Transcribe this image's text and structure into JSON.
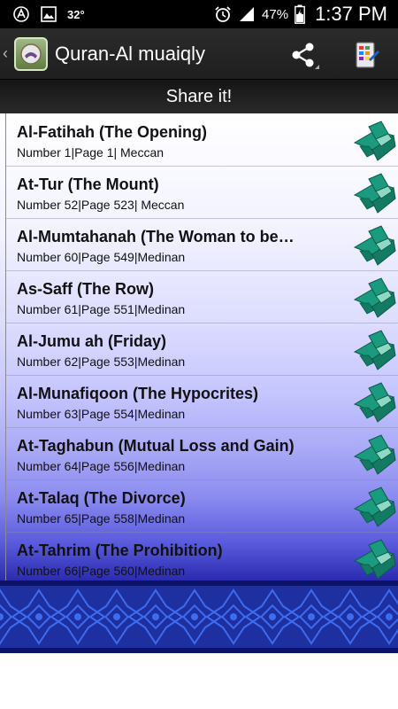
{
  "status_bar": {
    "temperature": "32°",
    "battery_percent": "47%",
    "time": "1:37 PM",
    "icons": [
      "a-circle-icon",
      "image-icon",
      "alarm-clock-icon",
      "signal-icon",
      "battery-icon"
    ]
  },
  "action_bar": {
    "title": "Quran-Al muaiqly",
    "icons": [
      "back-chevron-icon",
      "app-icon",
      "share-icon",
      "menu-icon"
    ]
  },
  "share_bar": {
    "label": "Share it!"
  },
  "surahs": [
    {
      "title": "Al-Fatihah (The Opening)",
      "subtitle": "Number 1|Page 1| Meccan"
    },
    {
      "title": "At-Tur (The Mount)",
      "subtitle": "Number 52|Page 523| Meccan"
    },
    {
      "title": "Al-Mumtahanah (The Woman to be…",
      "subtitle": "Number 60|Page 549|Medinan"
    },
    {
      "title": "As-Saff (The Row)",
      "subtitle": "Number 61|Page 551|Medinan"
    },
    {
      "title": "Al-Jumu ah (Friday)",
      "subtitle": "Number 62|Page 553|Medinan"
    },
    {
      "title": "Al-Munafiqoon (The Hypocrites)",
      "subtitle": "Number 63|Page 554|Medinan"
    },
    {
      "title": "At-Taghabun (Mutual Loss and Gain)",
      "subtitle": "Number 64|Page 556|Medinan"
    },
    {
      "title": "At-Talaq (The Divorce)",
      "subtitle": "Number 65|Page 558|Medinan"
    },
    {
      "title": "At-Tahrim (The Prohibition)",
      "subtitle": "Number 66|Page 560|Medinan"
    }
  ],
  "colors": {
    "book_icon": "#1a9a7e",
    "ornament_bg": "#1e2fa0",
    "ornament_pattern": "#3d6cf0"
  }
}
